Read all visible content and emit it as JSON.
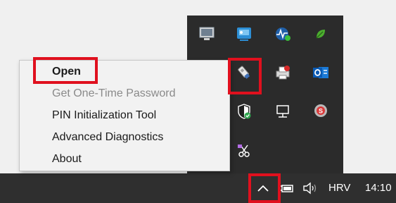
{
  "context_menu": {
    "items": [
      {
        "label": "Open",
        "enabled": true,
        "default": true
      },
      {
        "label": "Get One-Time Password",
        "enabled": false
      },
      {
        "label": "PIN Initialization Tool",
        "enabled": true
      },
      {
        "label": "Advanced Diagnostics",
        "enabled": true
      },
      {
        "label": "About",
        "enabled": true
      }
    ]
  },
  "tray_flyout": {
    "icons": [
      "monitor-icon",
      "display-settings-icon",
      "network-monitor-icon",
      "green-leaf-icon",
      "usb-token-icon",
      "printer-icon",
      "outlook-icon",
      "security-shield-icon",
      "network-adapter-icon",
      "antivirus-icon",
      "snipping-tool-icon"
    ]
  },
  "taskbar": {
    "language": "HRV",
    "clock": "14:10",
    "icons": [
      "chevron-up-icon",
      "power-plug-icon",
      "volume-icon"
    ]
  },
  "highlight_color": "#e0101e"
}
